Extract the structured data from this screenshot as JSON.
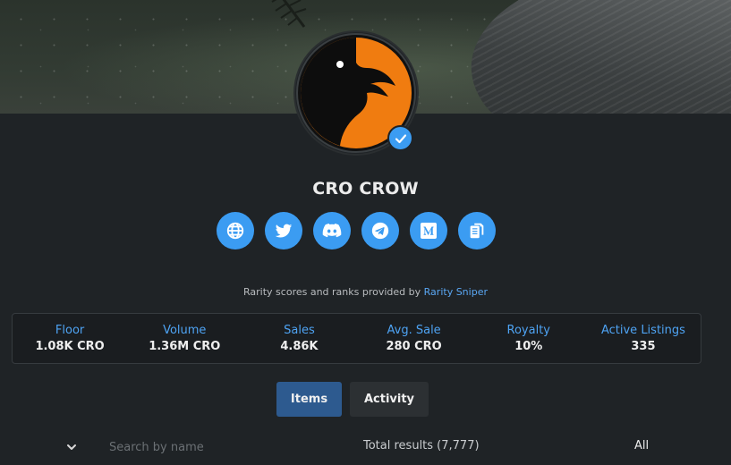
{
  "collection": {
    "name": "CRO CROW",
    "verified": true
  },
  "socials": [
    {
      "icon": "globe-icon"
    },
    {
      "icon": "twitter-icon"
    },
    {
      "icon": "discord-icon"
    },
    {
      "icon": "telegram-icon"
    },
    {
      "icon": "medium-icon"
    },
    {
      "icon": "copy-icon"
    }
  ],
  "rarity": {
    "text": "Rarity scores and ranks provided by",
    "link": "Rarity Sniper"
  },
  "stats": [
    {
      "label": "Floor",
      "value": "1.08K CRO"
    },
    {
      "label": "Volume",
      "value": "1.36M CRO"
    },
    {
      "label": "Sales",
      "value": "4.86K"
    },
    {
      "label": "Avg. Sale",
      "value": "280 CRO"
    },
    {
      "label": "Royalty",
      "value": "10%"
    },
    {
      "label": "Active Listings",
      "value": "335"
    }
  ],
  "tabs": {
    "items": "Items",
    "activity": "Activity"
  },
  "filter": {
    "search_placeholder": "Search by name",
    "total": "Total results (7,777)",
    "selected": "All"
  },
  "colors": {
    "accent": "#3b9cf2",
    "background": "#1f2326",
    "avatar_orange": "#f07c10"
  }
}
